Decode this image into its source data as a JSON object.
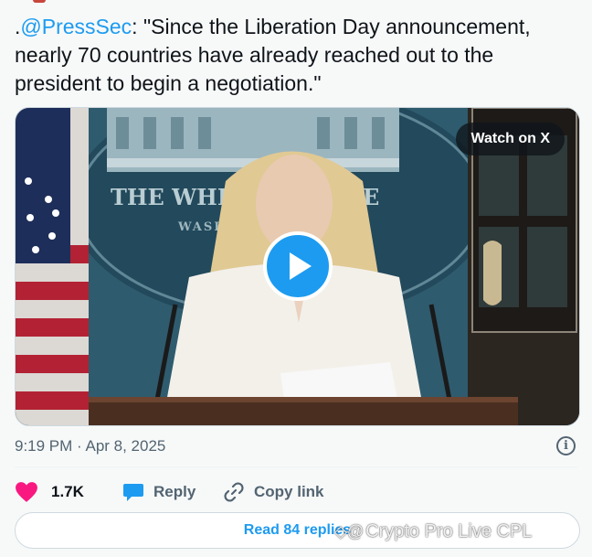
{
  "tweet": {
    "prefix": ".",
    "mention": "@PressSec",
    "body": ": \"Since the Liberation Day announcement, nearly 70 countries have already reached out to the president to begin a negotiation.\""
  },
  "media": {
    "watch_label": "Watch on X",
    "podium_seal_text_line1": "THE WHIT",
    "podium_seal_text_line1b": "E",
    "podium_seal_text_line2": "WASHIN"
  },
  "meta": {
    "timestamp": "9:19 PM · Apr 8, 2025"
  },
  "actions": {
    "like_count": "1.7K",
    "reply_label": "Reply",
    "copy_label": "Copy link"
  },
  "read_replies": "Read 84 replies",
  "watermark": "Crypto Pro Live CPL",
  "colors": {
    "accent": "#1d9bf0",
    "like": "#f91880",
    "text": "#0f1419",
    "muted": "#536471"
  },
  "icons": [
    "heart-icon",
    "reply-bubble-icon",
    "link-icon",
    "info-icon",
    "play-icon"
  ]
}
